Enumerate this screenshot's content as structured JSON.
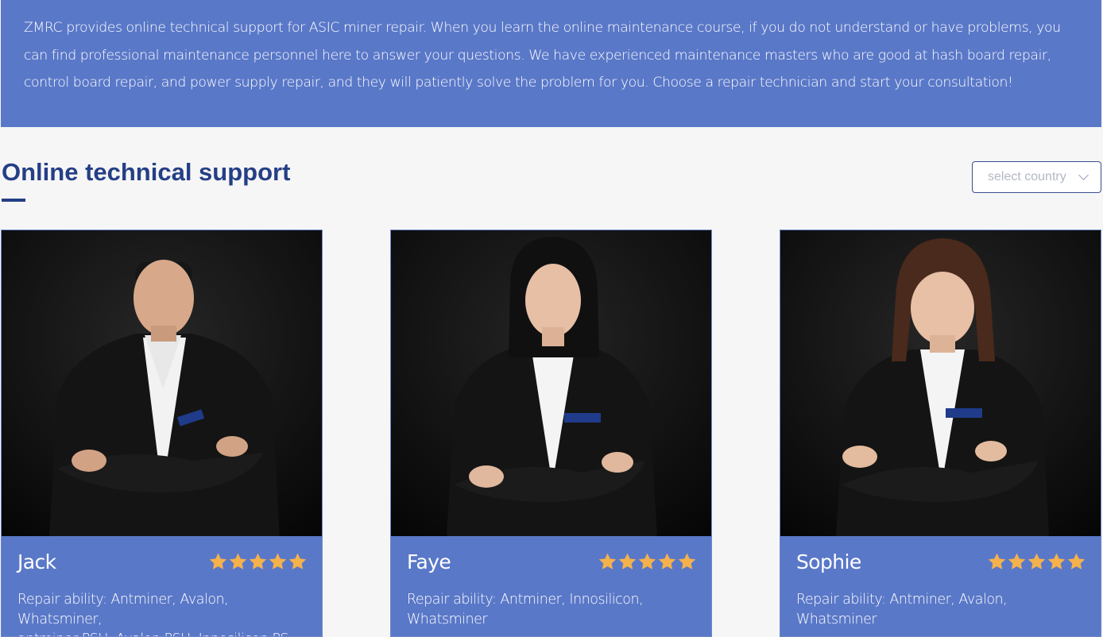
{
  "banner": {
    "text": "ZMRC provides online technical support for ASIC miner repair. When you learn the online maintenance course, if you do not understand or have problems, you can find professional maintenance personnel here to answer your questions. We have experienced maintenance masters who are good at hash board repair, control board repair, and power supply repair, and they will patiently solve the problem for you. Choose a repair technician and start your consultation!"
  },
  "section": {
    "title": "Online technical support",
    "country_placeholder": "select country"
  },
  "colors": {
    "accent": "#5a78c8",
    "title": "#253f86",
    "star": "#f5b14c"
  },
  "technicians": [
    {
      "name": "Jack",
      "rating": 5,
      "ability_line1": "Repair ability: Antminer, Avalon, Whatsminer,",
      "ability_line2": "antminer PSU, Avalon PSU, Innosilicon PS..."
    },
    {
      "name": "Faye",
      "rating": 5,
      "ability_line1": "Repair ability: Antminer, Innosilicon,",
      "ability_line2": "Whatsminer"
    },
    {
      "name": "Sophie",
      "rating": 5,
      "ability_line1": "Repair ability: Antminer, Avalon, Whatsminer",
      "ability_line2": ""
    }
  ]
}
